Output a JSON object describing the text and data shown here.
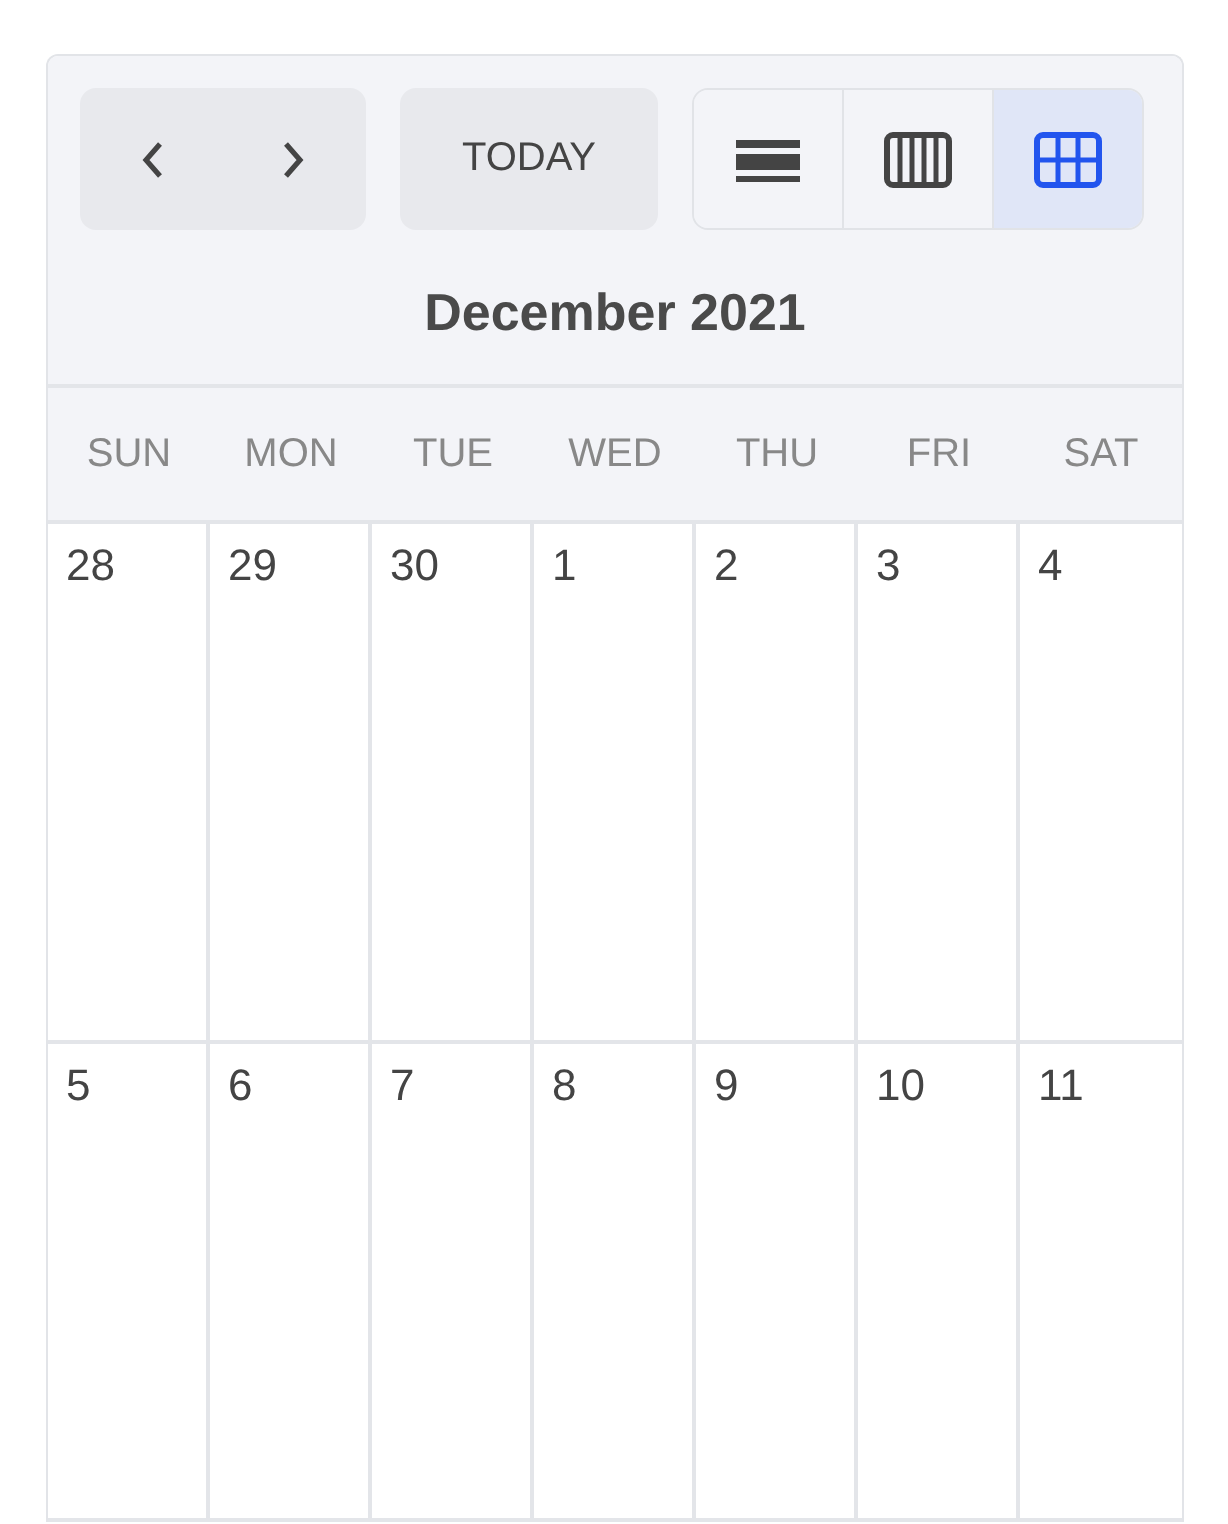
{
  "toolbar": {
    "today_button": "TODAY",
    "views": [
      {
        "kind": "list",
        "selected": false
      },
      {
        "kind": "week",
        "selected": false
      },
      {
        "kind": "month",
        "selected": true
      }
    ]
  },
  "title": "December 2021",
  "weekdays": [
    "SUN",
    "MON",
    "TUE",
    "WED",
    "THU",
    "FRI",
    "SAT"
  ],
  "weeks": [
    [
      "28",
      "29",
      "30",
      "1",
      "2",
      "3",
      "4"
    ],
    [
      "5",
      "6",
      "7",
      "8",
      "9",
      "10",
      "11"
    ]
  ]
}
